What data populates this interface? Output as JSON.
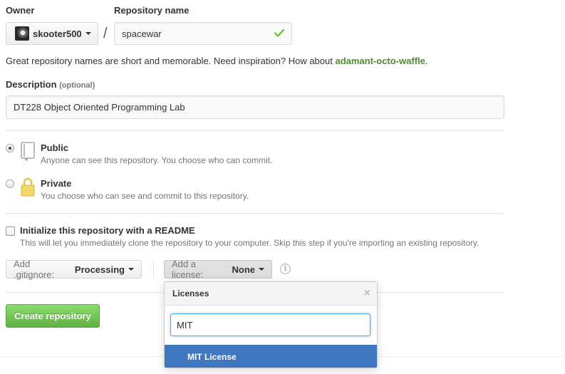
{
  "owner": {
    "label": "Owner",
    "name": "skooter500"
  },
  "separator": "/",
  "repo": {
    "label": "Repository name",
    "value": "spacewar"
  },
  "hint": {
    "text": "Great repository names are short and memorable. Need inspiration? How about ",
    "suggestion": "adamant-octo-waffle",
    "end": "."
  },
  "description": {
    "label": "Description",
    "optional": "(optional)",
    "value": "DT228 Object Oriented Programming Lab"
  },
  "visibility": {
    "public": {
      "title": "Public",
      "text": "Anyone can see this repository. You choose who can commit.",
      "selected": true
    },
    "private": {
      "title": "Private",
      "text": "You choose who can see and commit to this repository.",
      "selected": false
    }
  },
  "readme": {
    "label": "Initialize this repository with a README",
    "text": "This will let you immediately clone the repository to your computer. Skip this step if you're importing an existing repository.",
    "checked": false
  },
  "gitignore": {
    "prefix": "Add .gitignore:",
    "value": "Processing"
  },
  "license": {
    "prefix": "Add a license:",
    "value": "None"
  },
  "info_icon": "i",
  "create_button": "Create repository",
  "license_popup": {
    "title": "Licenses",
    "close": "×",
    "filter_value": "MIT",
    "items": [
      "MIT License"
    ]
  },
  "colors": {
    "accent_green": "#60b044",
    "link_green": "#4e8a2f",
    "selected_blue": "#4078c0"
  }
}
